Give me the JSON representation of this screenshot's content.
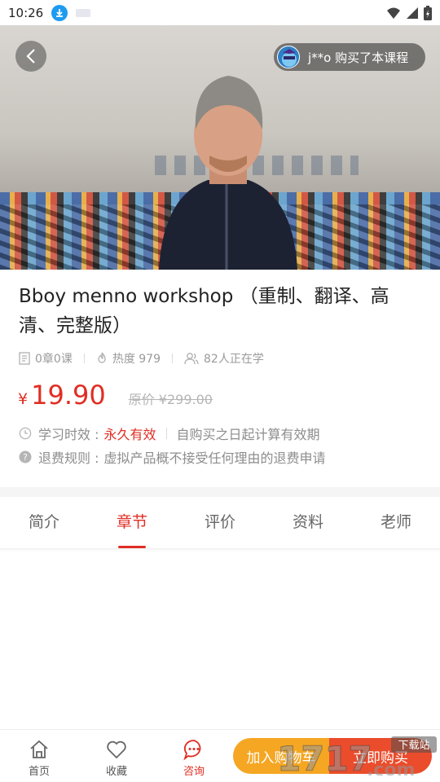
{
  "status": {
    "time": "10:26"
  },
  "banner": {
    "buyer_text": "j**o 购买了本课程"
  },
  "course": {
    "title": "Bboy menno workshop （重制、翻译、高清、完整版）",
    "chapters": "0章0课",
    "heat": "热度 979",
    "learners": "82人正在学",
    "price_symbol": "¥",
    "price": "19.90",
    "original_price": "原价 ¥299.00",
    "validity_label": "学习时效 :",
    "validity_value": "永久有效",
    "validity_note": "自购买之日起计算有效期",
    "refund_label": "退费规则 :",
    "refund_value": "虚拟产品概不接受任何理由的退费申请"
  },
  "tabs": [
    {
      "label": "简介"
    },
    {
      "label": "章节",
      "active": true
    },
    {
      "label": "评价"
    },
    {
      "label": "资料"
    },
    {
      "label": "老师"
    }
  ],
  "bottom_nav": {
    "home": "首页",
    "favorite": "收藏",
    "consult": "咨询",
    "add_cart": "加入购物车",
    "buy_now": "立即购买"
  },
  "watermark": {
    "text": "1717.com",
    "tag": "下载站"
  },
  "colors": {
    "accent": "#e02e24",
    "cart": "#f5a623",
    "buy": "#ea4c2c"
  }
}
